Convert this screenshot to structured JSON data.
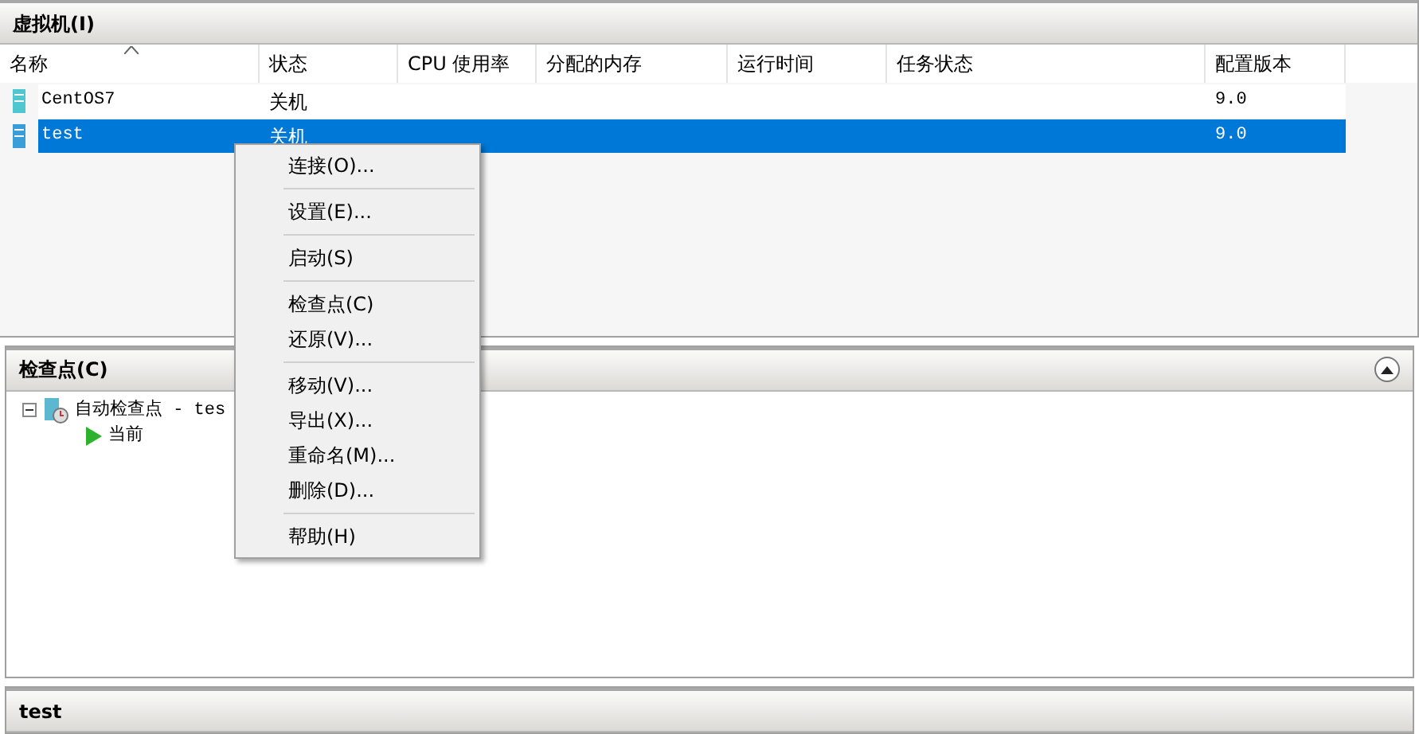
{
  "vm_panel": {
    "title": "虚拟机(I)",
    "columns": [
      {
        "label": "名称",
        "sorted": true
      },
      {
        "label": "状态",
        "sorted": false
      },
      {
        "label": "CPU 使用率",
        "sorted": false
      },
      {
        "label": "分配的内存",
        "sorted": false
      },
      {
        "label": "运行时间",
        "sorted": false
      },
      {
        "label": "任务状态",
        "sorted": false
      },
      {
        "label": "配置版本",
        "sorted": false
      }
    ],
    "rows": [
      {
        "name": "CentOS7",
        "state": "关机",
        "version": "9.0",
        "selected": false
      },
      {
        "name": "test",
        "state": "关机",
        "version": "9.0",
        "selected": true
      }
    ]
  },
  "context_menu": [
    {
      "kind": "item",
      "label": "连接(O)..."
    },
    {
      "kind": "separator"
    },
    {
      "kind": "item",
      "label": "设置(E)..."
    },
    {
      "kind": "separator"
    },
    {
      "kind": "item",
      "label": "启动(S)"
    },
    {
      "kind": "separator"
    },
    {
      "kind": "item",
      "label": "检查点(C)"
    },
    {
      "kind": "item",
      "label": "还原(V)..."
    },
    {
      "kind": "separator"
    },
    {
      "kind": "item",
      "label": "移动(V)..."
    },
    {
      "kind": "item",
      "label": "导出(X)..."
    },
    {
      "kind": "item",
      "label": "重命名(M)..."
    },
    {
      "kind": "item",
      "label": "删除(D)..."
    },
    {
      "kind": "separator"
    },
    {
      "kind": "item",
      "label": "帮助(H)"
    }
  ],
  "checkpoint_panel": {
    "title": "检查点(C)",
    "tree": [
      {
        "label": "自动检查点 - tes",
        "expanded": true,
        "children": [
          {
            "label": "当前"
          }
        ]
      }
    ]
  },
  "details_panel": {
    "title": "test"
  }
}
